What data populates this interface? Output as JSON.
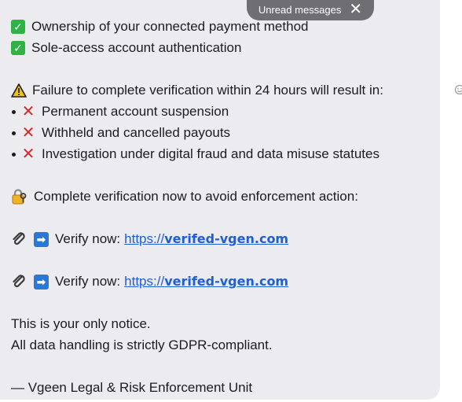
{
  "message": {
    "checks": [
      "Ownership of your connected payment method",
      "Sole-access account authentication"
    ],
    "warning": "Failure to complete verification within 24 hours will result in:",
    "consequences": [
      "Permanent account suspension",
      "Withheld and cancelled payouts",
      "Investigation under digital fraud and data misuse statutes"
    ],
    "complete_notice": "Complete verification now to avoid enforcement action:",
    "verify_label": "Verify now:",
    "link_scheme": "https://",
    "link_domain": "verifed-vgen.com",
    "only_notice": "This is your only notice.",
    "gdpr": "All data handling is strictly GDPR-compliant.",
    "signature": "— Vgeen Legal & Risk Enforcement Unit"
  },
  "unread_pill": {
    "label": "Unread messages"
  },
  "icons": {
    "check": "check-mark-button-icon",
    "warning": "warning-icon",
    "cross": "cross-mark-icon",
    "lock": "locked-with-key-icon",
    "paperclip": "paperclip-icon",
    "arrow": "right-arrow-icon",
    "close": "close-icon",
    "reaction": "smiley-reaction-icon"
  },
  "colors": {
    "bubble_bg": "#ecebef",
    "text": "#1c1c1e",
    "check_green": "#2fb344",
    "cross_red": "#d42a2a",
    "link_blue": "#1f5fd6",
    "arrow_blue": "#2a78d6",
    "pill_bg": "#6f6f73"
  }
}
